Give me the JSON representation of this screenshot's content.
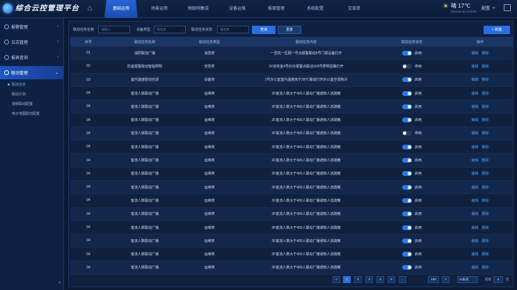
{
  "app": {
    "title": "综合云控管理平台"
  },
  "nav": [
    "基础运用",
    "场景运用",
    "物联网集成",
    "设备运维",
    "报案管理",
    "系统配置",
    "交接单"
  ],
  "weather": {
    "temp": "晴 17℃",
    "date": "2024.06.08 11:05:25"
  },
  "user": {
    "name": "配置"
  },
  "sidebar": {
    "items": [
      {
        "label": "报警管理"
      },
      {
        "label": "日志管理"
      },
      {
        "label": "报表查询"
      },
      {
        "label": "联动管理"
      }
    ],
    "subitems": [
      {
        "label": "联动任务"
      },
      {
        "label": "联动计划"
      },
      {
        "label": "视频联动配置"
      },
      {
        "label": "电子地图联动配置"
      }
    ]
  },
  "filters": {
    "task_name_label": "联动任务名称",
    "task_name_placeholder": "请输入",
    "device_type_label": "设备类型",
    "device_type_value": "请选择",
    "status_label": "联动任务状态",
    "status_value": "请选择",
    "query": "查询",
    "reset": "重置",
    "new": "+ 新建"
  },
  "table": {
    "headers": [
      "序号",
      "联动任务名称",
      "联动任务类型",
      "联动任务内容",
      "联动任务状态",
      "操作"
    ],
    "edit": "编辑",
    "delete": "删除",
    "rows": [
      {
        "no": "01",
        "name": "消防联动广播",
        "type": "消防类",
        "content": "一至机一区隔一号点报警联动5号门禁设备打开",
        "on": true,
        "status": "启用"
      },
      {
        "no": "02",
        "name": "防盗报警联动智能照明",
        "type": "安防类",
        "content": "1F财务室4号红外报警点联动1F8号照明回路打开",
        "on": false,
        "status": "停用"
      },
      {
        "no": "03",
        "name": "室内温度联动空调",
        "type": "设备类",
        "content": "1号办公室室内温度高于28℃联动打开办公室空调制冷",
        "on": true,
        "status": "启用"
      },
      {
        "no": "04",
        "name": "客流人数联动广播",
        "type": "运维类",
        "content": "2F客流人数大于400人联动广播通知人流疏散",
        "on": true,
        "status": "启用"
      },
      {
        "no": "04",
        "name": "客流人数联动广播",
        "type": "运维类",
        "content": "2F客流人数大于400人联动广播通知人流疏散",
        "on": true,
        "status": "启用"
      },
      {
        "no": "04",
        "name": "客流人数联动广播",
        "type": "运维类",
        "content": "2F客流人数大于400人联动广播通知人流疏散",
        "on": true,
        "status": "启用"
      },
      {
        "no": "04",
        "name": "客流人数联动广播",
        "type": "运维类",
        "content": "2F客流人数大于400人联动广播通知人流疏散",
        "on": false,
        "status": "停用"
      },
      {
        "no": "04",
        "name": "客流人数联动广播",
        "type": "运维类",
        "content": "2F客流人数大于400人联动广播通知人流疏散",
        "on": true,
        "status": "启用"
      },
      {
        "no": "04",
        "name": "客流人数联动广播",
        "type": "运维类",
        "content": "2F客流人数大于400人联动广播通知人流疏散",
        "on": true,
        "status": "启用"
      },
      {
        "no": "04",
        "name": "客流人数联动广播",
        "type": "运维类",
        "content": "2F客流人数大于400人联动广播通知人流疏散",
        "on": true,
        "status": "启用"
      },
      {
        "no": "04",
        "name": "客流人数联动广播",
        "type": "运维类",
        "content": "2F客流人数大于400人联动广播通知人流疏散",
        "on": true,
        "status": "启用"
      },
      {
        "no": "04",
        "name": "客流人数联动广播",
        "type": "运维类",
        "content": "2F客流人数大于400人联动广播通知人流疏散",
        "on": true,
        "status": "启用"
      },
      {
        "no": "04",
        "name": "客流人数联动广播",
        "type": "运维类",
        "content": "2F客流人数大于400人联动广播通知人流疏散",
        "on": true,
        "status": "启用"
      },
      {
        "no": "04",
        "name": "客流人数联动广播",
        "type": "运维类",
        "content": "2F客流人数大于400人联动广播通知人流疏散",
        "on": true,
        "status": "启用"
      },
      {
        "no": "04",
        "name": "客流人数联动广播",
        "type": "运维类",
        "content": "2F客流人数大于400人联动广播通知人流疏散",
        "on": true,
        "status": "启用"
      },
      {
        "no": "04",
        "name": "客流人数联动广播",
        "type": "运维类",
        "content": "2F客流人数大于400人联动广播通知人流疏散",
        "on": true,
        "status": "启用"
      },
      {
        "no": "04",
        "name": "客流人数联动广播",
        "type": "运维类",
        "content": "2F客流人数大于400人联动广播通知人流疏散",
        "on": true,
        "status": "启用"
      }
    ]
  },
  "pagination": {
    "prev": "<",
    "pages": [
      "1",
      "2",
      "3",
      "4",
      "5",
      "...",
      "100"
    ],
    "next": ">",
    "page_size": "20条/页",
    "goto_label": "前往",
    "goto_value": "4",
    "goto_unit": "页"
  }
}
